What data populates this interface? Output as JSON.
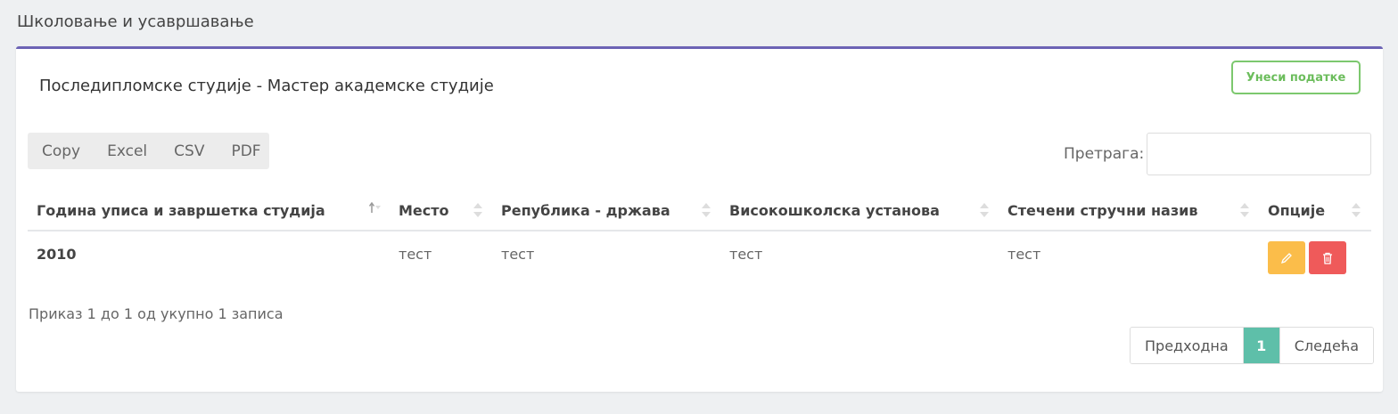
{
  "section": {
    "title": "Школовање и усавршавање"
  },
  "card": {
    "title": "Последипломске студије - Мастер академске студије",
    "enter_button": "Унеси податке"
  },
  "toolbar": {
    "export_buttons": [
      "Copy",
      "Excel",
      "CSV",
      "PDF"
    ],
    "search_label": "Претрага:",
    "search_value": ""
  },
  "table": {
    "columns": [
      "Година уписа и завршетка студија",
      "Место",
      "Република - држава",
      "Високошколска установа",
      "Стечени стручни назив",
      "Опције"
    ],
    "sorted_column": "Година уписа и завршетка студија",
    "rows": [
      {
        "year": "2010",
        "place": "тест",
        "republic": "тест",
        "institution": "тест",
        "title": "тест"
      }
    ]
  },
  "footer": {
    "info": "Приказ 1 до 1 од укупно 1 записа",
    "pagination": {
      "prev": "Предходна",
      "current": "1",
      "next": "Следећа"
    }
  },
  "colors": {
    "accent": "#6c63b5",
    "enter_button": "#6cbd5c",
    "edit": "#fbbd4a",
    "delete": "#ef5a5a",
    "page_active": "#5ebfa9"
  },
  "icons": {
    "edit": "pencil-icon",
    "delete": "trash-icon",
    "sort_asc": "sort-asc-icon",
    "sort": "sort-icon"
  }
}
